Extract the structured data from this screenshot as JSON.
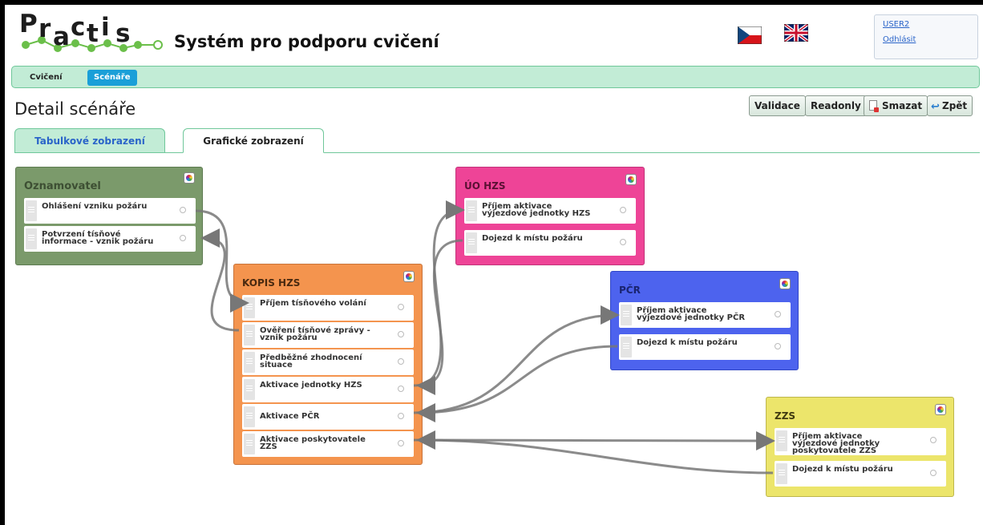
{
  "app": {
    "logo_text": "Practis",
    "title": "Systém pro podporu cvičení"
  },
  "user": {
    "name": "USER2",
    "logout": "Odhlásit"
  },
  "nav": {
    "items": [
      {
        "label": "Cvičení"
      },
      {
        "label": "Scénáře"
      }
    ]
  },
  "page": {
    "title": "Detail scénáře"
  },
  "actions": {
    "validate": "Validace",
    "readonly": "Readonly",
    "delete": "Smazat",
    "back": "Zpět"
  },
  "tabs": [
    {
      "label": "Tabulkové zobrazení"
    },
    {
      "label": "Grafické zobrazení"
    }
  ],
  "colors": {
    "oznamovatel": "#7b9a6b",
    "kopis": "#f4944e",
    "uo_hzs": "#ee4497",
    "pcr": "#4d63ee",
    "zzs": "#ece56b",
    "nav": "#c2ecd6",
    "nav_active": "#1a9fd8"
  },
  "boxes": {
    "oznamovatel": {
      "title": "Oznamovatel",
      "items": [
        "Ohlášení vzniku požáru",
        "Potvrzení tísňové informace - vznik požáru"
      ]
    },
    "kopis": {
      "title": "KOPIS HZS",
      "items": [
        "Příjem tísňového volání",
        "Ověření tísňové zprávy - vznik požáru",
        "Předběžné zhodnocení situace",
        "Aktivace jednotky HZS",
        "Aktivace PČR",
        "Aktivace poskytovatele ZZS"
      ]
    },
    "uo_hzs": {
      "title": "ÚO HZS",
      "items": [
        "Příjem aktivace výjezdové jednotky HZS",
        "Dojezd k místu požáru"
      ]
    },
    "pcr": {
      "title": "PČR",
      "items": [
        "Příjem aktivace výjezdové jednotky PČR",
        "Dojezd k místu požáru"
      ]
    },
    "zzs": {
      "title": "ZZS",
      "items": [
        "Příjem aktivace výjezdové jednotky poskytovatele ZZS",
        "Dojezd k místu požáru"
      ]
    }
  }
}
